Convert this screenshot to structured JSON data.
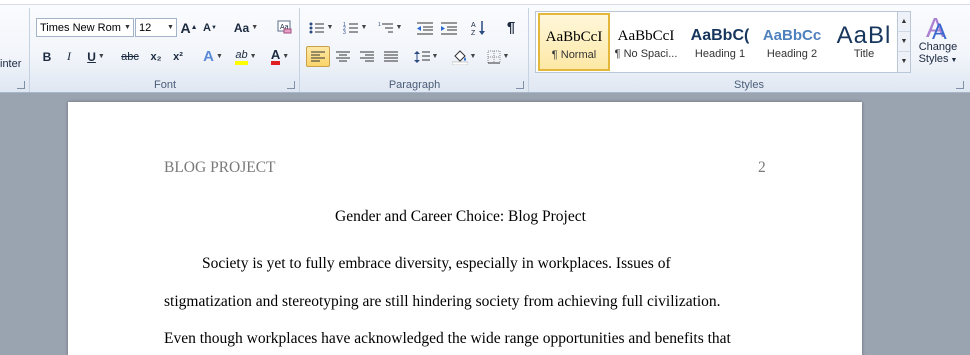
{
  "ribbon": {
    "clipboard": {
      "partial_label": "inter"
    },
    "font": {
      "label": "Font",
      "font_name": "Times New Rom",
      "font_size": "12",
      "grow_font": "A",
      "shrink_font": "A",
      "change_case": "Aa",
      "bold": "B",
      "italic": "I",
      "underline": "U",
      "strikethrough": "abc",
      "subscript": "x₂",
      "superscript": "x²",
      "text_effects": "A",
      "highlight": "ab",
      "font_color": "A"
    },
    "paragraph": {
      "label": "Paragraph",
      "show_marks": "¶"
    },
    "styles": {
      "label": "Styles",
      "items": [
        {
          "sample": "AaBbCcI",
          "name": "¶ Normal"
        },
        {
          "sample": "AaBbCcI",
          "name": "¶ No Spaci..."
        },
        {
          "sample": "AaBbC(",
          "name": "Heading 1"
        },
        {
          "sample": "AaBbCc",
          "name": "Heading 2"
        },
        {
          "sample": "AaBl",
          "name": "Title"
        }
      ],
      "change_styles_line1": "Change",
      "change_styles_line2": "Styles"
    }
  },
  "document": {
    "header_left": "BLOG PROJECT",
    "page_number": "2",
    "title": "Gender and Career Choice: Blog Project",
    "lines": [
      "Society is yet to fully embrace diversity, especially in workplaces. Issues of",
      "stigmatization and stereotyping are still hindering society from achieving full civilization.",
      "Even though workplaces have acknowledged the wide range opportunities and benefits that"
    ]
  },
  "colors": {
    "highlight": "#ffff00",
    "font_color": "#e02020",
    "heading": "#17365d",
    "active": "#fbd46a"
  }
}
